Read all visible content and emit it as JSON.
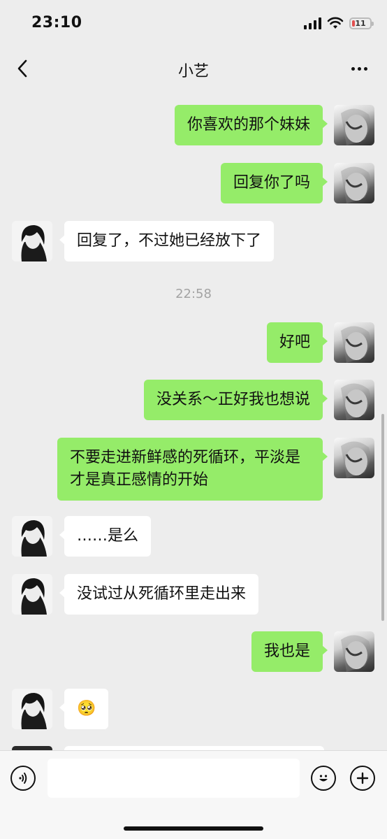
{
  "status_bar": {
    "time": "23:10",
    "battery_level": "11",
    "icons": [
      "signal-icon",
      "wifi-icon",
      "battery-icon"
    ]
  },
  "nav": {
    "title": "小艺",
    "back_icon": "chevron-left-icon",
    "more_icon": "more-icon"
  },
  "messages": [
    {
      "from": "me",
      "text": "你喜欢的那个妹妹"
    },
    {
      "from": "me",
      "text": "回复你了吗"
    },
    {
      "from": "other",
      "text": "回复了，不过她已经放下了"
    },
    {
      "timestamp": "22:58"
    },
    {
      "from": "me",
      "text": "好吧"
    },
    {
      "from": "me",
      "text": "没关系～正好我也想说"
    },
    {
      "from": "me",
      "text": "不要走进新鲜感的死循环，平淡是才是真正感情的开始"
    },
    {
      "from": "other",
      "text": "……是么"
    },
    {
      "from": "other",
      "text": "没试过从死循环里走出来"
    },
    {
      "from": "me",
      "text": "我也是"
    },
    {
      "from": "other",
      "text": "🥺"
    }
  ],
  "input_bar": {
    "placeholder": "",
    "icons": [
      "voice-icon",
      "emoji-icon",
      "plus-icon"
    ]
  },
  "colors": {
    "my_bubble": "#95ec69",
    "other_bubble": "#ffffff",
    "background": "#ededed"
  }
}
